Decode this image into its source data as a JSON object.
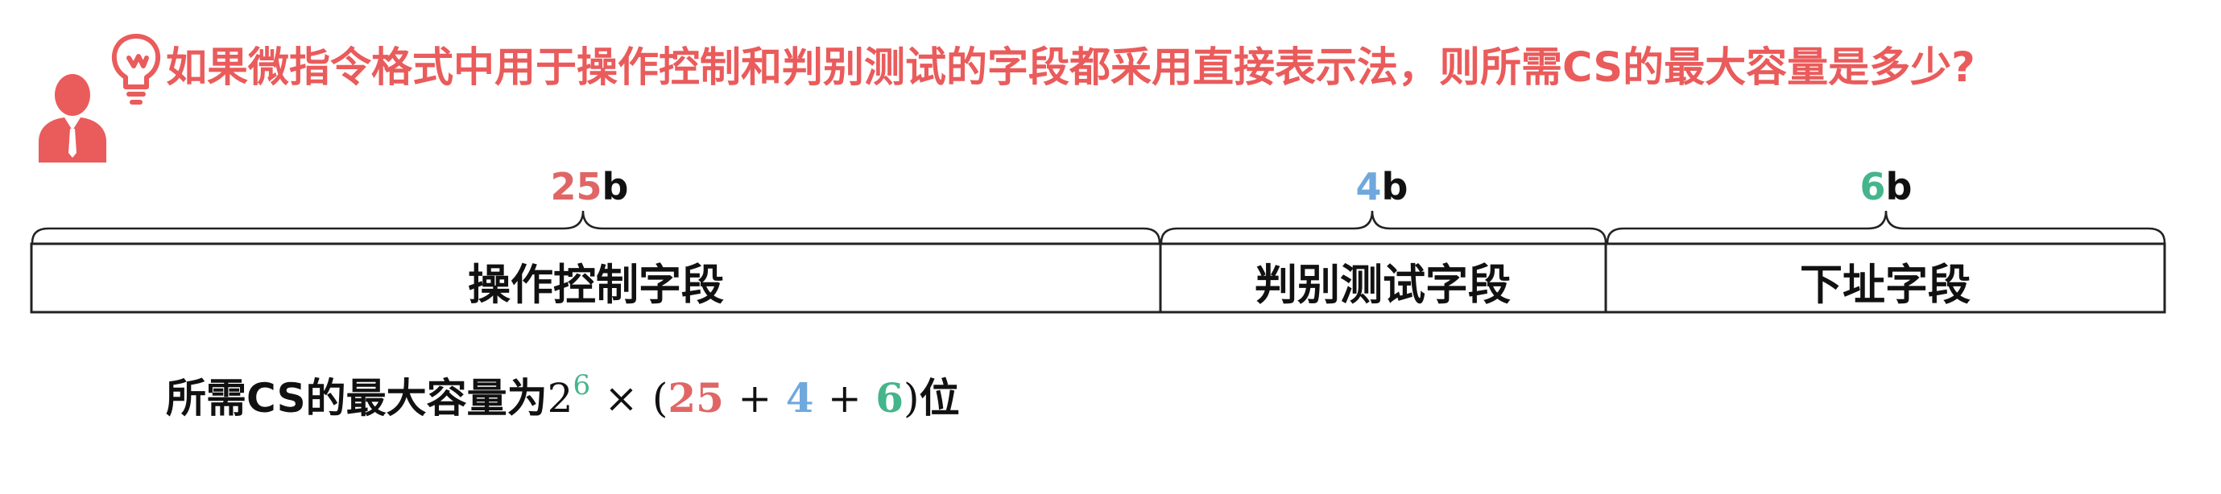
{
  "question": "如果微指令格式中用于操作控制和判别测试的字段都采用直接表示法，则所需CS的最大容量是多少?",
  "colors": {
    "accent_red": "#ea5b5b",
    "field1": "#e06666",
    "field2": "#6fa8dc",
    "field3": "#45b58b"
  },
  "fields": [
    {
      "bits": "25",
      "unit": "b",
      "label": "操作控制字段"
    },
    {
      "bits": "4",
      "unit": "b",
      "label": "判别测试字段"
    },
    {
      "bits": "6",
      "unit": "b",
      "label": "下址字段"
    }
  ],
  "formula": {
    "prefix": "所需CS的最大容量为",
    "base": "2",
    "exponent": "6",
    "times": "×",
    "open_paren": "(",
    "term1": "25",
    "plus1": "+",
    "term2": "4",
    "plus2": "+",
    "term3": "6",
    "close_paren": ")",
    "suffix": "位"
  },
  "icons": {
    "person": "person-with-idea-icon"
  }
}
